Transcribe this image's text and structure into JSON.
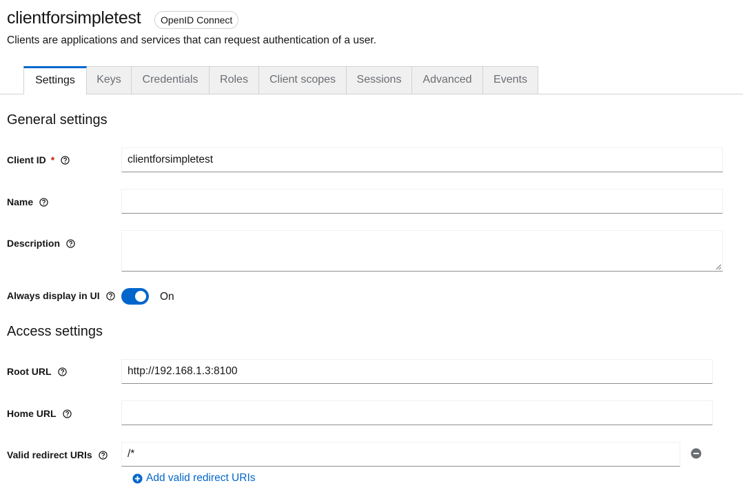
{
  "header": {
    "title": "clientforsimpletest",
    "badge": "OpenID Connect",
    "description": "Clients are applications and services that can request authentication of a user."
  },
  "tabs": [
    {
      "label": "Settings",
      "active": true
    },
    {
      "label": "Keys"
    },
    {
      "label": "Credentials"
    },
    {
      "label": "Roles"
    },
    {
      "label": "Client scopes"
    },
    {
      "label": "Sessions"
    },
    {
      "label": "Advanced"
    },
    {
      "label": "Events"
    }
  ],
  "general_settings": {
    "title": "General settings",
    "client_id": {
      "label": "Client ID",
      "required_mark": "*",
      "value": "clientforsimpletest"
    },
    "name": {
      "label": "Name",
      "value": ""
    },
    "description": {
      "label": "Description",
      "value": ""
    },
    "always_display": {
      "label": "Always display in UI",
      "state": "On"
    }
  },
  "access_settings": {
    "title": "Access settings",
    "root_url": {
      "label": "Root URL",
      "value": "http://192.168.1.3:8100"
    },
    "home_url": {
      "label": "Home URL",
      "value": ""
    },
    "redirect_uris": {
      "label": "Valid redirect URIs",
      "value": "/*",
      "add_label": "Add valid redirect URIs"
    }
  },
  "colors": {
    "accent": "#0066cc",
    "required": "#c9190b",
    "remove_icon": "#6a6e73"
  }
}
